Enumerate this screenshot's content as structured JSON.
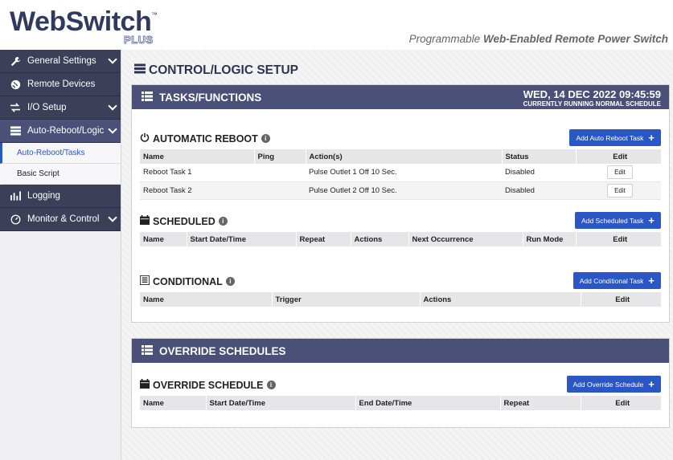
{
  "header": {
    "logo_main": "WebSwitch",
    "logo_tm": "™",
    "logo_plus": "PLUS",
    "tagline_prefix": "Programmable ",
    "tagline_bold": "Web-Enabled Remote Power Switch"
  },
  "sidebar": {
    "items": [
      {
        "label": "General Settings",
        "icon": "wrench-icon"
      },
      {
        "label": "Remote Devices",
        "icon": "globe-icon"
      },
      {
        "label": "I/O Setup",
        "icon": "arrows-icon"
      },
      {
        "label": "Auto-Reboot/Logic",
        "icon": "server-icon"
      },
      {
        "label": "Auto-Reboot/Tasks"
      },
      {
        "label": "Basic Script"
      },
      {
        "label": "Logging",
        "icon": "chart-icon"
      },
      {
        "label": "Monitor & Control",
        "icon": "gauge-icon"
      }
    ]
  },
  "main": {
    "page_title": "CONTROL/LOGIC SETUP",
    "tasks": {
      "title": "TASKS/FUNCTIONS",
      "date": "WED, 14 DEC 2022 09:45:59",
      "schedule_status": "CURRENTLY RUNNING NORMAL SCHEDULE",
      "auto_reboot": {
        "title": "AUTOMATIC REBOOT",
        "button": "Add Auto Reboot Task",
        "columns": [
          "Name",
          "Ping",
          "Action(s)",
          "Status",
          "Edit"
        ],
        "rows": [
          {
            "name": "Reboot Task 1",
            "ping": "",
            "action": "Pulse Outlet 1 Off 10 Sec.",
            "status": "Disabled",
            "edit": "Edit"
          },
          {
            "name": "Reboot Task 2",
            "ping": "",
            "action": "Pulse Outlet 2 Off 10 Sec.",
            "status": "Disabled",
            "edit": "Edit"
          }
        ]
      },
      "scheduled": {
        "title": "SCHEDULED",
        "button": "Add Scheduled Task",
        "columns": [
          "Name",
          "Start Date/Time",
          "Repeat",
          "Actions",
          "Next Occurrence",
          "Run Mode",
          "Edit"
        ]
      },
      "conditional": {
        "title": "CONDITIONAL",
        "button": "Add Conditional Task",
        "columns": [
          "Name",
          "Trigger",
          "Actions",
          "Edit"
        ]
      }
    },
    "override": {
      "title": "OVERRIDE SCHEDULES",
      "schedule": {
        "title": "OVERRIDE SCHEDULE",
        "button": "Add Override Schedule",
        "columns": [
          "Name",
          "Start Date/Time",
          "End Date/Time",
          "Repeat",
          "Edit"
        ]
      }
    }
  },
  "colors": {
    "nav_bg": "#3c3f58",
    "nav_active": "#4a5077",
    "card_head": "#4a5077",
    "accent": "#2a56c6"
  }
}
